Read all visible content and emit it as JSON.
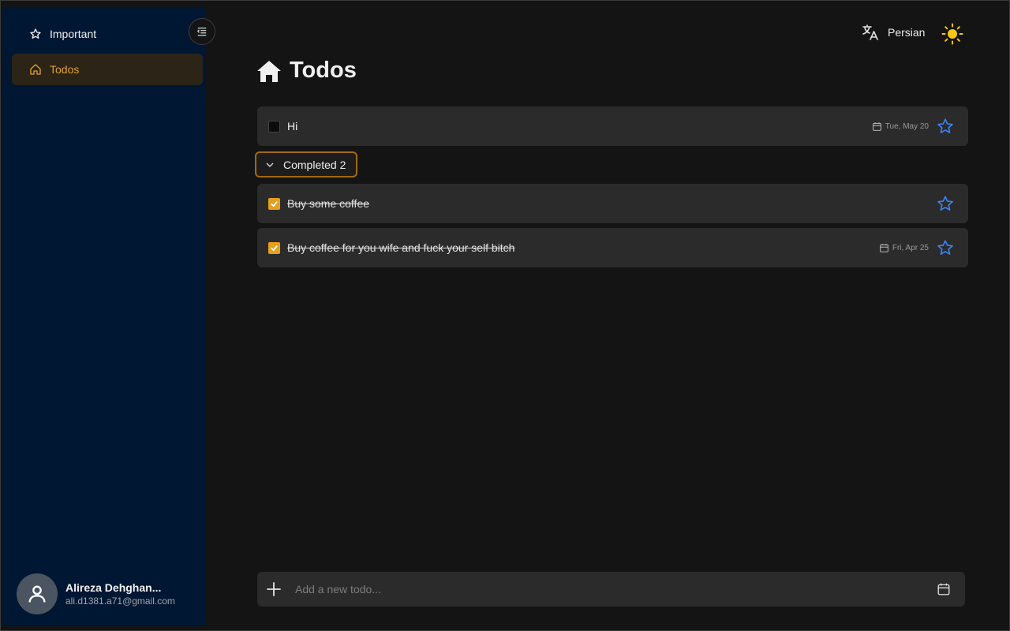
{
  "sidebar": {
    "items": [
      {
        "label": "Important",
        "icon": "star-outline-icon"
      },
      {
        "label": "Todos",
        "icon": "home-outline-icon",
        "active": true
      }
    ],
    "profile": {
      "name": "Alireza Dehghan...",
      "email": "ali.d1381.a71@gmail.com"
    }
  },
  "header": {
    "language_label": "Persian",
    "theme_icon": "sun-icon"
  },
  "page": {
    "title": "Todos",
    "title_icon": "home-icon"
  },
  "todos": [
    {
      "text": "Hi",
      "completed": false,
      "date": "Tue, May 20",
      "starred": false
    }
  ],
  "completed_section": {
    "label": "Completed 2",
    "items": [
      {
        "text": "Buy some coffee",
        "completed": true,
        "date": "",
        "starred": false
      },
      {
        "text": "Buy coffee for you wife and fuck your self bitch",
        "completed": true,
        "date": "Fri, Apr 25",
        "starred": false
      }
    ]
  },
  "add_bar": {
    "placeholder": "Add a new todo..."
  },
  "colors": {
    "sidebar_bg": "#001733",
    "accent": "#e6a01e",
    "star_blue": "#3b82f6",
    "sun_yellow": "#f5c518",
    "background": "#141414",
    "row_bg": "#2b2b2b"
  }
}
